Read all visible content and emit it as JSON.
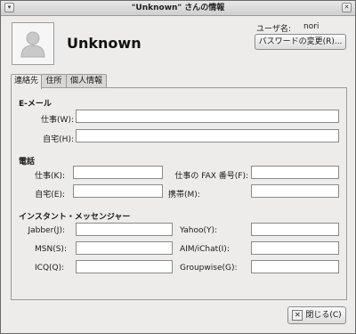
{
  "window": {
    "title": "\"Unknown\" さんの情報"
  },
  "header": {
    "name": "Unknown",
    "username_label": "ユーザ名:",
    "username_value": "nori",
    "change_password_label": "パスワードの変更(R)..."
  },
  "tabs": [
    {
      "label": "連絡先",
      "active": true
    },
    {
      "label": "住所",
      "active": false
    },
    {
      "label": "個人情報",
      "active": false
    }
  ],
  "email": {
    "heading": "E-メール",
    "work_label": "仕事(W):",
    "work_value": "",
    "home_label": "自宅(H):",
    "home_value": ""
  },
  "phone": {
    "heading": "電話",
    "work_label": "仕事(K):",
    "work_value": "",
    "fax_label": "仕事の FAX 番号(F):",
    "fax_value": "",
    "home_label": "自宅(E):",
    "home_value": "",
    "mobile_label": "携帯(M):",
    "mobile_value": ""
  },
  "im": {
    "heading": "インスタント・メッセンジャー",
    "jabber_label": "Jabber(J):",
    "jabber_value": "",
    "yahoo_label": "Yahoo(Y):",
    "yahoo_value": "",
    "msn_label": "MSN(S):",
    "msn_value": "",
    "aim_label": "AIM/iChat(I):",
    "aim_value": "",
    "icq_label": "ICQ(Q):",
    "icq_value": "",
    "groupwise_label": "Groupwise(G):",
    "groupwise_value": ""
  },
  "footer": {
    "close_label": "閉じる(C)"
  },
  "icons": {
    "avatar": "user-silhouette-icon",
    "window_menu": "window-menu-icon",
    "window_close": "close-icon",
    "close_button": "close-icon"
  }
}
